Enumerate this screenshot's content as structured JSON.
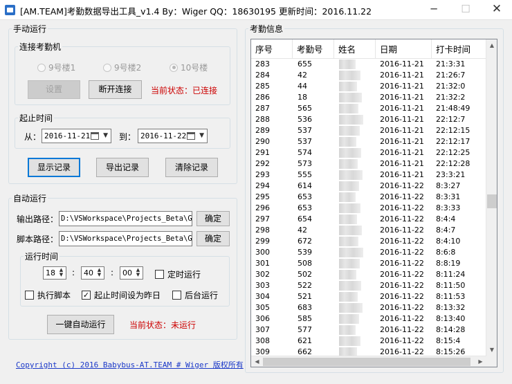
{
  "window": {
    "title": "[AM.TEAM]考勤数据导出工具_v1.4   By：Wiger QQ：18630195   更新时间：2016.11.22",
    "min_glyph": "─",
    "max_glyph": "☐",
    "close_glyph": "✕"
  },
  "manual": {
    "group_title": "手动运行",
    "connect_title": "连接考勤机",
    "radios": [
      {
        "label": "9号楼1",
        "checked": false
      },
      {
        "label": "9号楼2",
        "checked": false
      },
      {
        "label": "10号楼",
        "checked": true
      }
    ],
    "settings_button": "设置",
    "disconnect_button": "断开连接",
    "status": "当前状态：已连接",
    "range_title": "起止时间",
    "from_label": "从：",
    "from_date": "2016-11-21",
    "to_label": "到：",
    "to_date": "2016-11-22",
    "show_button": "显示记录",
    "export_button": "导出记录",
    "clear_button": "清除记录"
  },
  "auto": {
    "group_title": "自动运行",
    "output_label": "输出路径：",
    "output_path": "D:\\VSWorkspace\\Projects_Beta\\Ge",
    "output_ok": "确定",
    "script_label": "脚本路径：",
    "script_path": "D:\\VSWorkspace\\Projects_Beta\\Ge",
    "script_ok": "确定",
    "runtime_title": "运行时间",
    "hour": "18",
    "minute": "40",
    "second": "00",
    "colon": ":",
    "timed_run": {
      "label": "定时运行",
      "checked": false
    },
    "exec_script": {
      "label": "执行脚本",
      "checked": false
    },
    "start_yesterday": {
      "label": "起止时间设为昨日",
      "checked": true
    },
    "background": {
      "label": "后台运行",
      "checked": false
    },
    "one_click_button": "一键自动运行",
    "status": "当前状态：未运行"
  },
  "copyright": "Copyright (c) 2016 Babybus-AT.TEAM # Wiger 版权所有",
  "records": {
    "group_title": "考勤信息",
    "columns": [
      "序号",
      "考勤号",
      "姓名",
      "日期",
      "打卡时间"
    ],
    "rows": [
      [
        "283",
        "655",
        "2016-11-21",
        "21:3:31"
      ],
      [
        "284",
        "42",
        "2016-11-21",
        "21:26:7"
      ],
      [
        "285",
        "44",
        "2016-11-21",
        "21:32:0"
      ],
      [
        "286",
        "18",
        "2016-11-21",
        "21:32:2"
      ],
      [
        "287",
        "565",
        "2016-11-21",
        "21:48:49"
      ],
      [
        "288",
        "536",
        "2016-11-21",
        "22:12:7"
      ],
      [
        "289",
        "537",
        "2016-11-21",
        "22:12:15"
      ],
      [
        "290",
        "537",
        "2016-11-21",
        "22:12:17"
      ],
      [
        "291",
        "574",
        "2016-11-21",
        "22:12:25"
      ],
      [
        "292",
        "573",
        "2016-11-21",
        "22:12:28"
      ],
      [
        "293",
        "555",
        "2016-11-21",
        "23:3:21"
      ],
      [
        "294",
        "614",
        "2016-11-22",
        "8:3:27"
      ],
      [
        "295",
        "653",
        "2016-11-22",
        "8:3:31"
      ],
      [
        "296",
        "653",
        "2016-11-22",
        "8:3:33"
      ],
      [
        "297",
        "654",
        "2016-11-22",
        "8:4:4"
      ],
      [
        "298",
        "42",
        "2016-11-22",
        "8:4:7"
      ],
      [
        "299",
        "672",
        "2016-11-22",
        "8:4:10"
      ],
      [
        "300",
        "539",
        "2016-11-22",
        "8:6:8"
      ],
      [
        "301",
        "508",
        "2016-11-22",
        "8:8:19"
      ],
      [
        "302",
        "502",
        "2016-11-22",
        "8:11:24"
      ],
      [
        "303",
        "522",
        "2016-11-22",
        "8:11:50"
      ],
      [
        "304",
        "521",
        "2016-11-22",
        "8:11:53"
      ],
      [
        "305",
        "683",
        "2016-11-22",
        "8:13:32"
      ],
      [
        "306",
        "585",
        "2016-11-22",
        "8:13:40"
      ],
      [
        "307",
        "577",
        "2016-11-22",
        "8:14:28"
      ],
      [
        "308",
        "621",
        "2016-11-22",
        "8:15:4"
      ],
      [
        "309",
        "662",
        "2016-11-22",
        "8:15:26"
      ]
    ]
  }
}
